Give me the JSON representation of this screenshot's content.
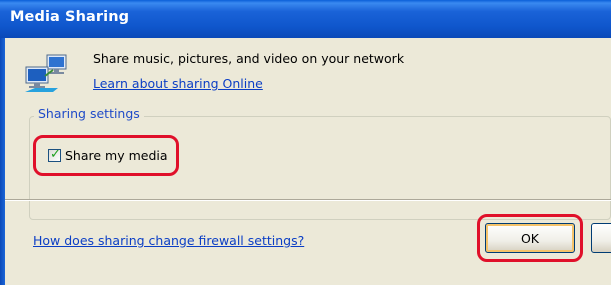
{
  "window": {
    "title": "Media Sharing"
  },
  "intro": {
    "description": "Share music, pictures, and video on your network",
    "learn_link": "Learn about sharing Online",
    "icon": "network-sharing-icon"
  },
  "settings": {
    "group_label": "Sharing settings",
    "share_checkbox": {
      "label": "Share my media",
      "checked": true
    }
  },
  "footer": {
    "firewall_link": "How does sharing change firewall settings?",
    "ok_label": "OK"
  },
  "colors": {
    "title_bar": "#0f56cc",
    "link": "#0b3ec5",
    "highlight": "#e0102a",
    "dialog_bg": "#ece9d8"
  }
}
